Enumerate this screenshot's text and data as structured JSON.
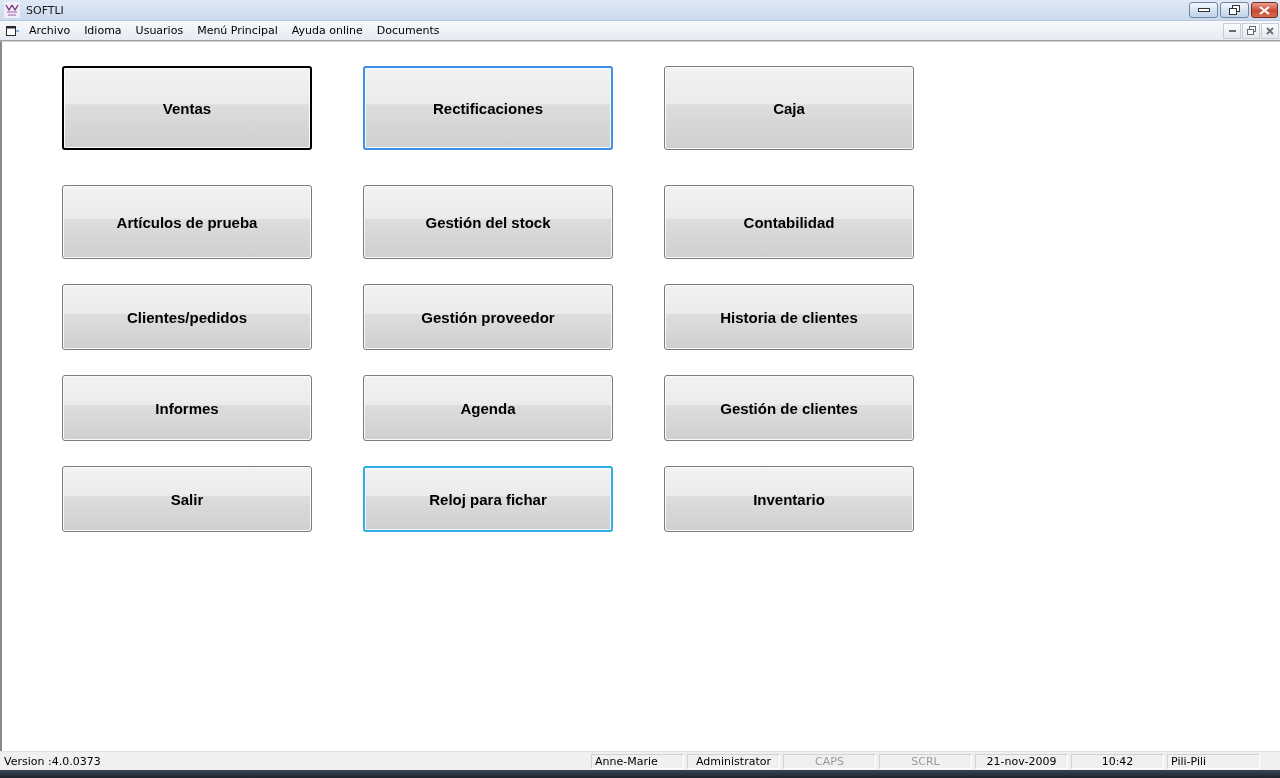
{
  "window": {
    "title": "SOFTLI"
  },
  "menu_bar": {
    "items": [
      "Archivo",
      "Idioma",
      "Usuarios",
      "Menú Principal",
      "Ayuda online",
      "Documents"
    ]
  },
  "buttons": [
    {
      "label": "Ventas",
      "focused": true,
      "pressed": false,
      "hovered": false
    },
    {
      "label": "Rectificaciones",
      "focused": false,
      "pressed": true,
      "hovered": false
    },
    {
      "label": "Caja",
      "focused": false,
      "pressed": false,
      "hovered": false
    },
    {
      "label": "Artículos de prueba",
      "focused": false,
      "pressed": false,
      "hovered": false
    },
    {
      "label": "Gestión del stock",
      "focused": false,
      "pressed": false,
      "hovered": false
    },
    {
      "label": "Contabilidad",
      "focused": false,
      "pressed": false,
      "hovered": false
    },
    {
      "label": "Clientes/pedidos",
      "focused": false,
      "pressed": false,
      "hovered": false
    },
    {
      "label": "Gestión proveedor",
      "focused": false,
      "pressed": false,
      "hovered": false
    },
    {
      "label": "Historia de clientes",
      "focused": false,
      "pressed": false,
      "hovered": false
    },
    {
      "label": "Informes",
      "focused": false,
      "pressed": false,
      "hovered": false
    },
    {
      "label": "Agenda",
      "focused": false,
      "pressed": false,
      "hovered": false
    },
    {
      "label": "Gestión de clientes",
      "focused": false,
      "pressed": false,
      "hovered": false
    },
    {
      "label": "Salir",
      "focused": false,
      "pressed": false,
      "hovered": false
    },
    {
      "label": "Reloj para fichar",
      "focused": false,
      "pressed": false,
      "hovered": true
    },
    {
      "label": "Inventario",
      "focused": false,
      "pressed": false,
      "hovered": false
    }
  ],
  "status_bar": {
    "version": "Version :4.0.0373",
    "panels": [
      {
        "text": "Anne-Marie",
        "disabled": false
      },
      {
        "text": "Administrator",
        "disabled": false
      },
      {
        "text": "CAPS",
        "disabled": true
      },
      {
        "text": "SCRL",
        "disabled": true
      },
      {
        "text": "21-nov-2009",
        "disabled": false
      },
      {
        "text": "10:42",
        "disabled": false
      },
      {
        "text": "Pili-Pili",
        "disabled": false
      }
    ]
  }
}
